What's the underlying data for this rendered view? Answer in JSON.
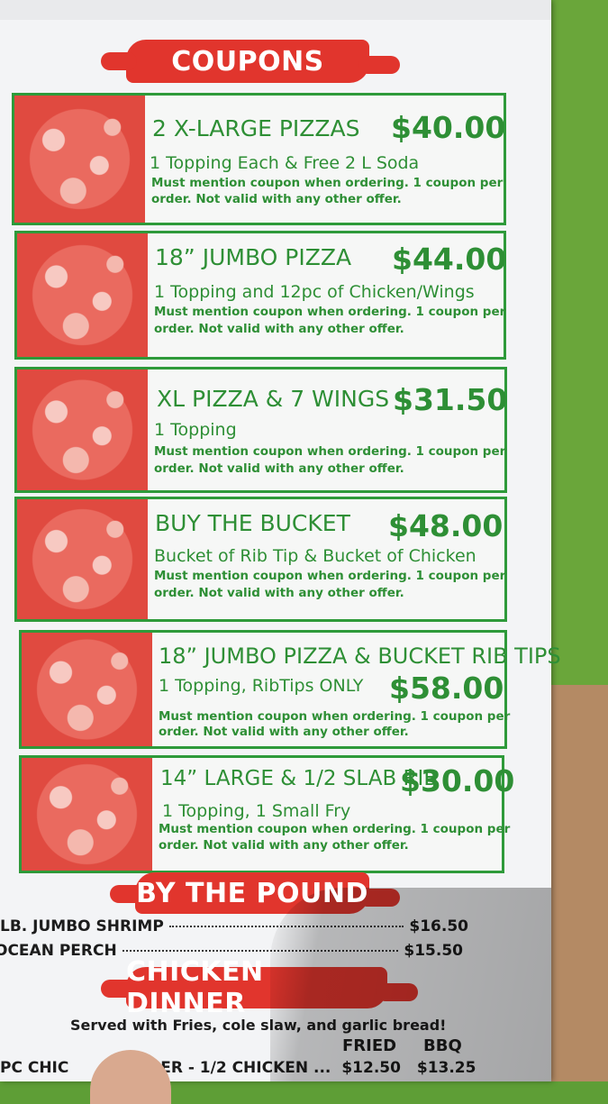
{
  "headers": {
    "coupons": "COUPONS",
    "by_the_pound": "BY THE POUND",
    "chicken_dinner": "CHICKEN DINNER"
  },
  "coupons": [
    {
      "title": "2 X-LARGE PIZZAS",
      "price": "$40.00",
      "subtitle": "1 Topping Each & Free 2 L Soda",
      "fine_print_1": "Must mention coupon when ordering. 1 coupon per",
      "fine_print_2": "order. Not valid with any other offer."
    },
    {
      "title": "18” JUMBO PIZZA",
      "price": "$44.00",
      "subtitle": "1 Topping and 12pc of Chicken/Wings",
      "fine_print_1": "Must mention coupon when ordering. 1 coupon per",
      "fine_print_2": "order. Not valid with any other offer."
    },
    {
      "title": "XL PIZZA & 7 WINGS",
      "price": "$31.50",
      "subtitle": "1 Topping",
      "fine_print_1": "Must mention coupon when ordering. 1 coupon per",
      "fine_print_2": "order. Not valid with any other offer."
    },
    {
      "title": "BUY THE BUCKET",
      "price": "$48.00",
      "subtitle": "Bucket of Rib Tip & Bucket of Chicken",
      "fine_print_1": "Must mention coupon when ordering. 1 coupon per",
      "fine_print_2": "order. Not valid with any other offer."
    },
    {
      "title": "18” JUMBO PIZZA & BUCKET RIB TIPS",
      "price": "$58.00",
      "subtitle": "1 Topping, RibTips ONLY",
      "fine_print_1": "Must mention coupon when ordering. 1 coupon per",
      "fine_print_2": "order. Not valid with any other offer."
    },
    {
      "title": "14” LARGE & 1/2 SLAB RIB",
      "price": "$30.00",
      "subtitle": "1 Topping, 1 Small Fry",
      "fine_print_1": "Must mention coupon when ordering. 1 coupon per",
      "fine_print_2": "order. Not valid with any other offer."
    }
  ],
  "by_the_pound": [
    {
      "name": "LB. JUMBO SHRIMP",
      "price": "$16.50"
    },
    {
      "name": "OCEAN PERCH",
      "price": "$15.50"
    }
  ],
  "chicken_dinner": {
    "served_with": "Served with Fries, cole slaw, and garlic bread!",
    "col_fried": "FRIED",
    "col_bbq": "BBQ",
    "row_name": "PC CHIC",
    "row_name_tail": "ER - 1/2 CHICKEN ...",
    "row_fried": "$12.50",
    "row_bbq": "$13.25"
  },
  "colors": {
    "accent_green": "#2e8f35",
    "brush_red": "#e1352d"
  }
}
